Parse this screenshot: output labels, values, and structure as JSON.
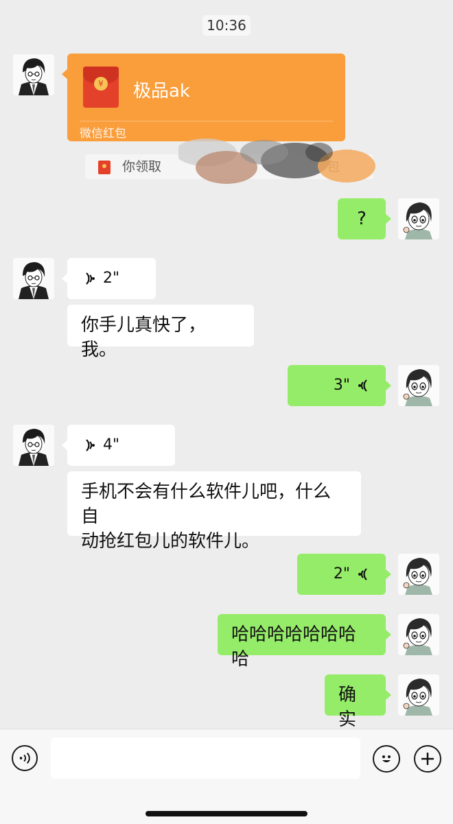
{
  "status": {
    "time": "10:36"
  },
  "colors": {
    "self_bubble": "#95ec69",
    "other_bubble": "#ffffff",
    "red_packet": "#fa9d3b",
    "background": "#ededed"
  },
  "red_packet": {
    "title": "极品ak",
    "footer": "微信红包",
    "coin_symbol": "¥"
  },
  "notice": {
    "text_start": "你领取",
    "text_end": "包"
  },
  "messages": {
    "m1": "?",
    "m2_duration": "2\"",
    "m3": "你手儿真快了，我。",
    "m4_duration": "3\"",
    "m5_duration": "4\"",
    "m6_line1": "手机不会有什么软件儿吧，什么自",
    "m6_line2": "动抢红包儿的软件儿。",
    "m7_duration": "2\"",
    "m8": "哈哈哈哈哈哈哈哈",
    "m9": "确实"
  },
  "input_bar": {
    "voice_icon": "voice-mode-icon",
    "emoji_icon": "emoji-icon",
    "plus_icon": "plus-icon",
    "input_value": ""
  }
}
